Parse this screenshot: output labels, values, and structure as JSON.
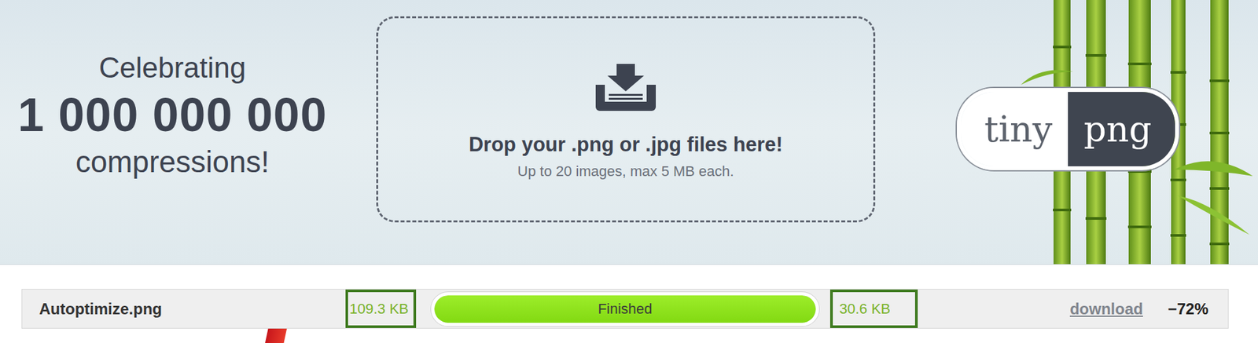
{
  "header": {
    "celebrating": "Celebrating",
    "count": "1 000 000 000",
    "suffix": "compressions!"
  },
  "dropzone": {
    "title": "Drop your .png or .jpg files here!",
    "subtitle": "Up to 20 images, max 5 MB each."
  },
  "logo": {
    "left": "tiny",
    "right": "png"
  },
  "files": [
    {
      "name": "Autoptimize.png",
      "original_size": "109.3 KB",
      "original_highlighted": true,
      "level": 1,
      "status": "Finished",
      "new_size": "30.6 KB",
      "new_highlighted": true,
      "download": "download",
      "savings": "−72%"
    }
  ]
}
